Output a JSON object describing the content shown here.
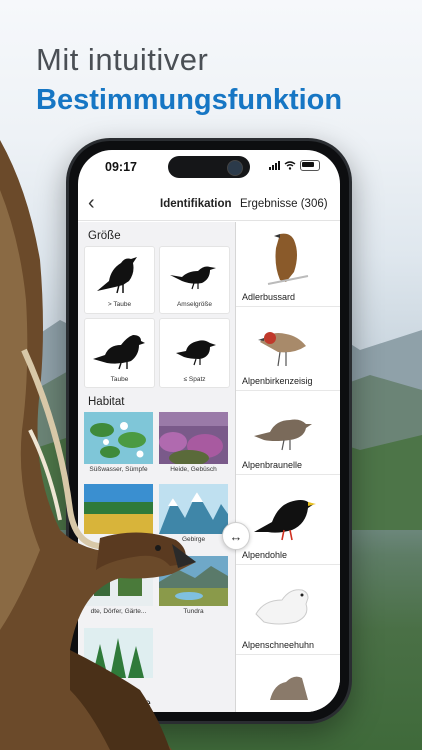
{
  "promo": {
    "line1": "Mit intuitiver",
    "line2": "Bestimmungsfunktion"
  },
  "status_bar": {
    "time": "09:17",
    "icons": [
      "signal-icon",
      "wifi-icon",
      "battery-icon"
    ]
  },
  "nav": {
    "back_icon": "chevron-left-icon",
    "identify_label": "Identifikation",
    "results_label": "Ergebnisse (306)"
  },
  "filters": {
    "size_title": "Größe",
    "size_options": [
      {
        "label": "> Taube"
      },
      {
        "label": "Amselgröße"
      },
      {
        "label": "Taube"
      },
      {
        "label": "≤ Spatz"
      }
    ],
    "habitat_title": "Habitat",
    "habitat_options": [
      {
        "label": "Süßwasser, Sümpfe"
      },
      {
        "label": "Heide, Gebüsch"
      },
      {
        "label": ""
      },
      {
        "label": "Gebirge"
      },
      {
        "label": "dte, Dörfer, Gärte..."
      },
      {
        "label": "Tundra"
      },
      {
        "label": ""
      }
    ],
    "next_title_partial": "ge"
  },
  "results": [
    {
      "name": "Adlerbussard"
    },
    {
      "name": "Alpenbirkenzeisig"
    },
    {
      "name": "Alpenbraunelle"
    },
    {
      "name": "Alpendohle"
    },
    {
      "name": "Alpenschneehuhn"
    },
    {
      "name": ""
    }
  ],
  "split_handle_icon": "split-arrows-icon",
  "colors": {
    "accent_blue": "#1676c4",
    "headline_gray": "#4a4f55"
  }
}
